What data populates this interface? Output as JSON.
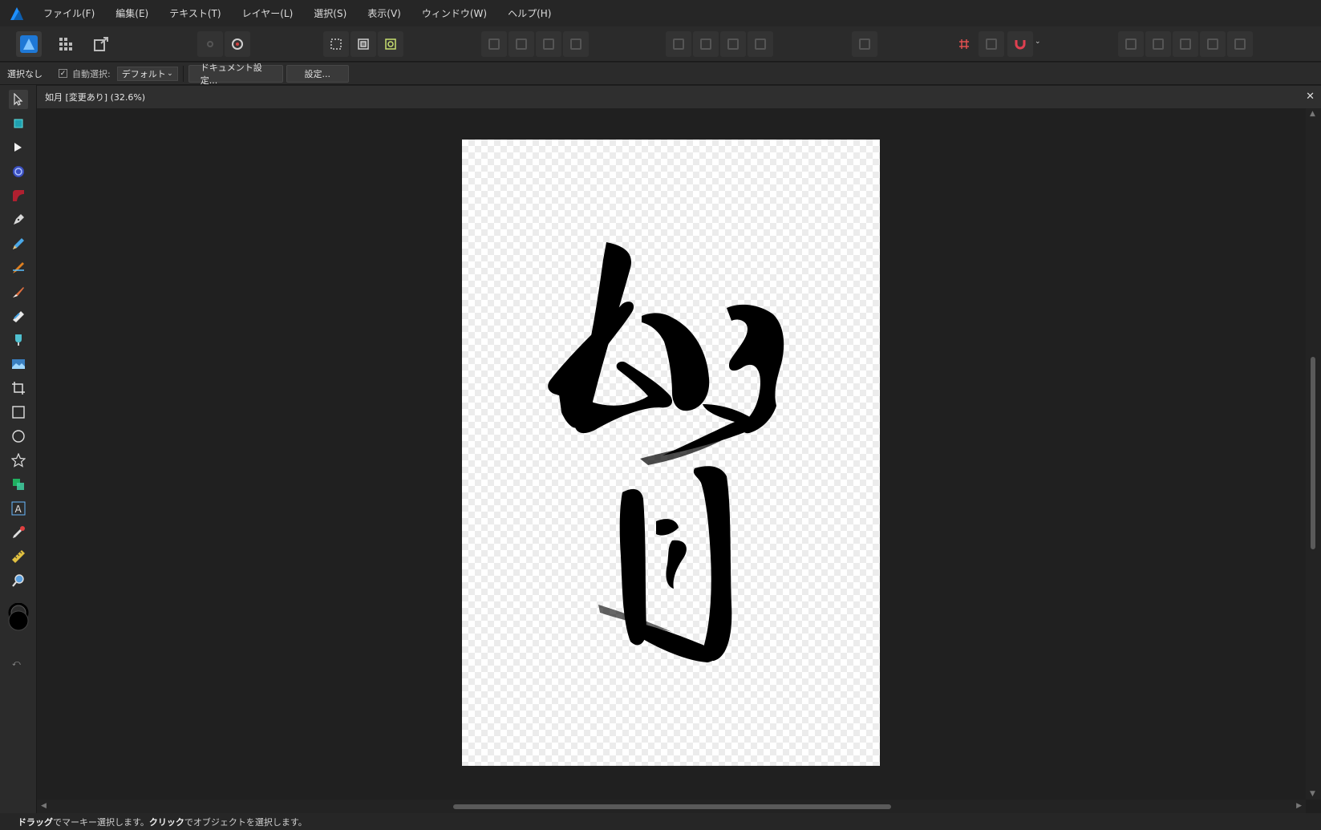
{
  "menu": {
    "items": [
      "ファイル(F)",
      "編集(E)",
      "テキスト(T)",
      "レイヤー(L)",
      "選択(S)",
      "表示(V)",
      "ウィンドウ(W)",
      "ヘルプ(H)"
    ]
  },
  "context": {
    "selection": "選択なし",
    "auto_select_label": "自動選択:",
    "auto_select_checked": true,
    "auto_select_value": "デフォルト",
    "document_setup": "ドキュメント設定...",
    "settings": "設定..."
  },
  "document": {
    "tab_title": "如月 [変更あり] (32.6%)"
  },
  "status": {
    "drag": "ドラッグ",
    "drag_text": "でマーキー選択します。",
    "click": "クリック",
    "click_text": "でオブジェクトを選択します。"
  },
  "colors": {
    "accent": "#1e90ff",
    "ink": "#000000"
  }
}
